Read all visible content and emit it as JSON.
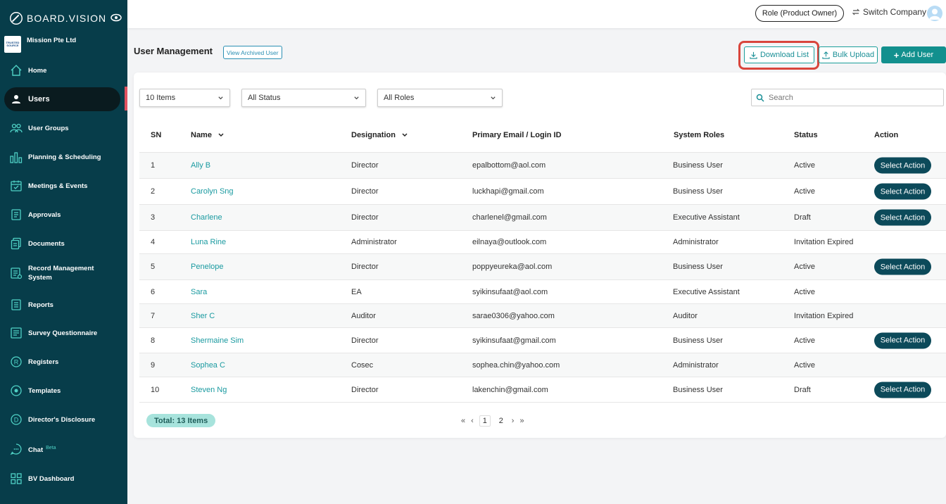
{
  "brand": {
    "name": "BOARD.VISION"
  },
  "company": {
    "name": "Mission Pte Ltd",
    "logo_text": "TRUSTED SOURCE"
  },
  "sidebar": {
    "items": [
      {
        "label": "Home",
        "icon": "home-icon"
      },
      {
        "label": "Users",
        "icon": "user-icon",
        "active": true
      },
      {
        "label": "User Groups",
        "icon": "user-group-icon"
      },
      {
        "label": "Planning & Scheduling",
        "icon": "bar-chart-icon"
      },
      {
        "label": "Meetings & Events",
        "icon": "calendar-icon"
      },
      {
        "label": "Approvals",
        "icon": "approval-doc-icon"
      },
      {
        "label": "Documents",
        "icon": "documents-icon"
      },
      {
        "label": "Record Management System",
        "icon": "record-icon"
      },
      {
        "label": "Reports",
        "icon": "report-icon"
      },
      {
        "label": "Survey Questionnaire",
        "icon": "survey-icon"
      },
      {
        "label": "Registers",
        "icon": "registers-icon"
      },
      {
        "label": "Templates",
        "icon": "templates-icon"
      },
      {
        "label": "Director's Disclosure",
        "icon": "disclosure-icon"
      },
      {
        "label": "Chat",
        "icon": "chat-icon",
        "badge": "Beta"
      },
      {
        "label": "BV Dashboard",
        "icon": "dashboard-icon"
      }
    ]
  },
  "topbar": {
    "role_label": "Role (Product Owner)",
    "switch_label": "Switch Company"
  },
  "page": {
    "title": "User Management",
    "archived_label": "View Archived User",
    "download_label": "Download List",
    "bulk_label": "Bulk Upload",
    "add_label": "Add User"
  },
  "filters": {
    "items_select": "10 Items",
    "status_select": "All Status",
    "roles_select": "All Roles",
    "search_placeholder": "Search"
  },
  "table": {
    "headers": {
      "sn": "SN",
      "name": "Name",
      "designation": "Designation",
      "email": "Primary Email / Login ID",
      "roles": "System Roles",
      "status": "Status",
      "action": "Action"
    },
    "action_label": "Select Action",
    "rows": [
      {
        "sn": "1",
        "name": "Ally B",
        "designation": "Director",
        "email": "epalbottom@aol.com",
        "role": "Business User",
        "status": "Active",
        "has_action": true
      },
      {
        "sn": "2",
        "name": "Carolyn Sng",
        "designation": "Director",
        "email": "luckhapi@gmail.com",
        "role": "Business User",
        "status": "Active",
        "has_action": true
      },
      {
        "sn": "3",
        "name": "Charlene",
        "designation": "Director",
        "email": "charlenel@gmail.com",
        "role": "Executive Assistant",
        "status": "Draft",
        "has_action": true
      },
      {
        "sn": "4",
        "name": "Luna Rine",
        "designation": "Administrator",
        "email": "eilnaya@outlook.com",
        "role": "Administrator",
        "status": "Invitation Expired",
        "has_action": false
      },
      {
        "sn": "5",
        "name": "Penelope",
        "designation": "Director",
        "email": "poppyeureka@aol.com",
        "role": "Business User",
        "status": "Active",
        "has_action": true
      },
      {
        "sn": "6",
        "name": "Sara",
        "designation": "EA",
        "email": "syikinsufaat@aol.com",
        "role": "Executive Assistant",
        "status": "Active",
        "has_action": false
      },
      {
        "sn": "7",
        "name": "Sher C",
        "designation": "Auditor",
        "email": "sarae0306@yahoo.com",
        "role": "Auditor",
        "status": "Invitation Expired",
        "has_action": false
      },
      {
        "sn": "8",
        "name": "Shermaine Sim",
        "designation": "Director",
        "email": "syikinsufaat@gmail.com",
        "role": "Business User",
        "status": "Active",
        "has_action": true
      },
      {
        "sn": "9",
        "name": "Sophea C",
        "designation": "Cosec",
        "email": "sophea.chin@yahoo.com",
        "role": "Administrator",
        "status": "Active",
        "has_action": false
      },
      {
        "sn": "10",
        "name": "Steven Ng",
        "designation": "Director",
        "email": "lakenchin@gmail.com",
        "role": "Business User",
        "status": "Draft",
        "has_action": true
      }
    ]
  },
  "footer": {
    "total_label": "Total: 13 Items",
    "pages": [
      "1",
      "2"
    ],
    "current_page": "1"
  },
  "colors": {
    "sidebar_bg": "#073d4a",
    "accent": "#12908e",
    "link": "#1a9aa0",
    "action_btn": "#0c4a5a",
    "highlight": "#d9453c"
  }
}
